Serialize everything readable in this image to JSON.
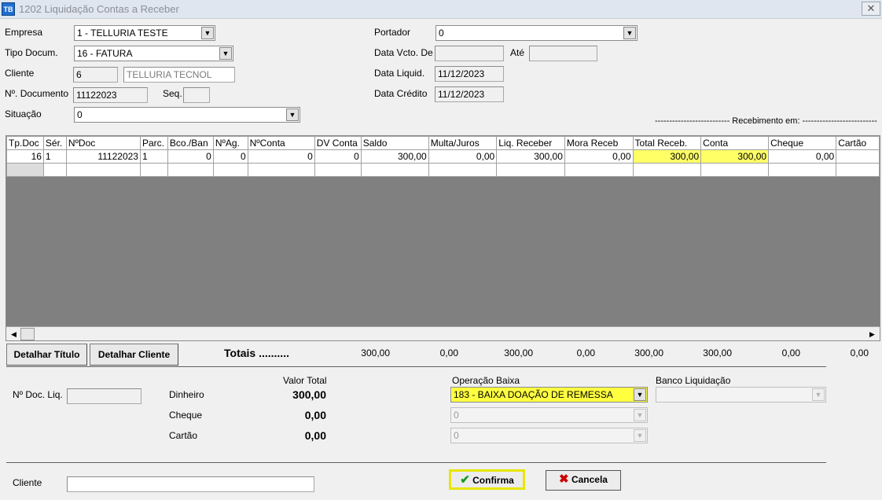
{
  "window": {
    "icon_label": "TB",
    "title": "1202 Liquidação Contas a Receber",
    "close_glyph": "✕"
  },
  "header": {
    "empresa_label": "Empresa",
    "empresa_value": "1 - TELLURIA TESTE",
    "tipo_label": "Tipo Docum.",
    "tipo_value": "16 - FATURA",
    "cliente_label": "Cliente",
    "cliente_code": "6",
    "cliente_name": "TELLURIA TECNOL",
    "documento_label": "Nº. Documento",
    "documento_value": "11122023",
    "seq_label": "Seq.",
    "seq_value": "",
    "situacao_label": "Situação",
    "situacao_value": "0",
    "portador_label": "Portador",
    "portador_value": "0",
    "data_vcto_label": "Data Vcto. De",
    "data_vcto_de": "",
    "ate_label": "Até",
    "data_vcto_ate": "",
    "data_liquid_label": "Data Liquid.",
    "data_liquid_value": "11/12/2023",
    "data_credito_label": "Data Crédito",
    "data_credito_value": "11/12/2023",
    "recebimento_label": "-------------------------- Recebimento em: --------------------------"
  },
  "grid": {
    "columns": [
      "Tp.Doc",
      "Sér.",
      "NºDoc",
      "Parc.",
      "Bco./Ban",
      "NºAg.",
      "NºConta",
      "DV Conta",
      "Saldo",
      "Multa/Juros",
      "Liq. Receber",
      "Mora Receb",
      "Total Receb.",
      "Conta",
      "Cheque",
      "Cartão"
    ],
    "rows": [
      [
        "16",
        "1",
        "11122023",
        "1",
        "0",
        "0",
        "0",
        "0",
        "300,00",
        "0,00",
        "300,00",
        "0,00",
        "300,00",
        "300,00",
        "0,00",
        ""
      ]
    ],
    "left_arrow": "◀",
    "right_arrow": "▶"
  },
  "actions": {
    "detalhar_titulo": "Detalhar Título",
    "detalhar_cliente": "Detalhar Cliente"
  },
  "totais": {
    "label": "Totais ..........",
    "saldo": "300,00",
    "multa": "0,00",
    "liq_receber": "300,00",
    "mora": "0,00",
    "total_receb": "300,00",
    "conta": "300,00",
    "cheque": "0,00",
    "cartao": "0,00"
  },
  "footer": {
    "doc_liq_label": "Nº Doc. Liq.",
    "doc_liq_value": "",
    "valor_total_label": "Valor Total",
    "dinheiro_label": "Dinheiro",
    "dinheiro_value": "300,00",
    "cheque_label": "Cheque",
    "cheque_value": "0,00",
    "cartao_label": "Cartão",
    "cartao_value": "0,00",
    "operacao_label": "Operação Baixa",
    "operacao_value": "183 - BAIXA DOAÇÃO DE REMESSA",
    "operacao_cheque_value": "0",
    "operacao_cartao_value": "0",
    "banco_label": "Banco Liquidação",
    "banco_value": "",
    "cliente_label": "Cliente",
    "cliente_value": "",
    "confirma_label": "Confirma",
    "cancela_label": "Cancela",
    "confirma_icon": "✔",
    "cancela_icon": "✖"
  },
  "colors": {
    "highlight": "#ffff66",
    "confirm_border": "#e6e600",
    "cancel_icon": "#cc0000",
    "confirm_icon": "#1a9a1a"
  }
}
